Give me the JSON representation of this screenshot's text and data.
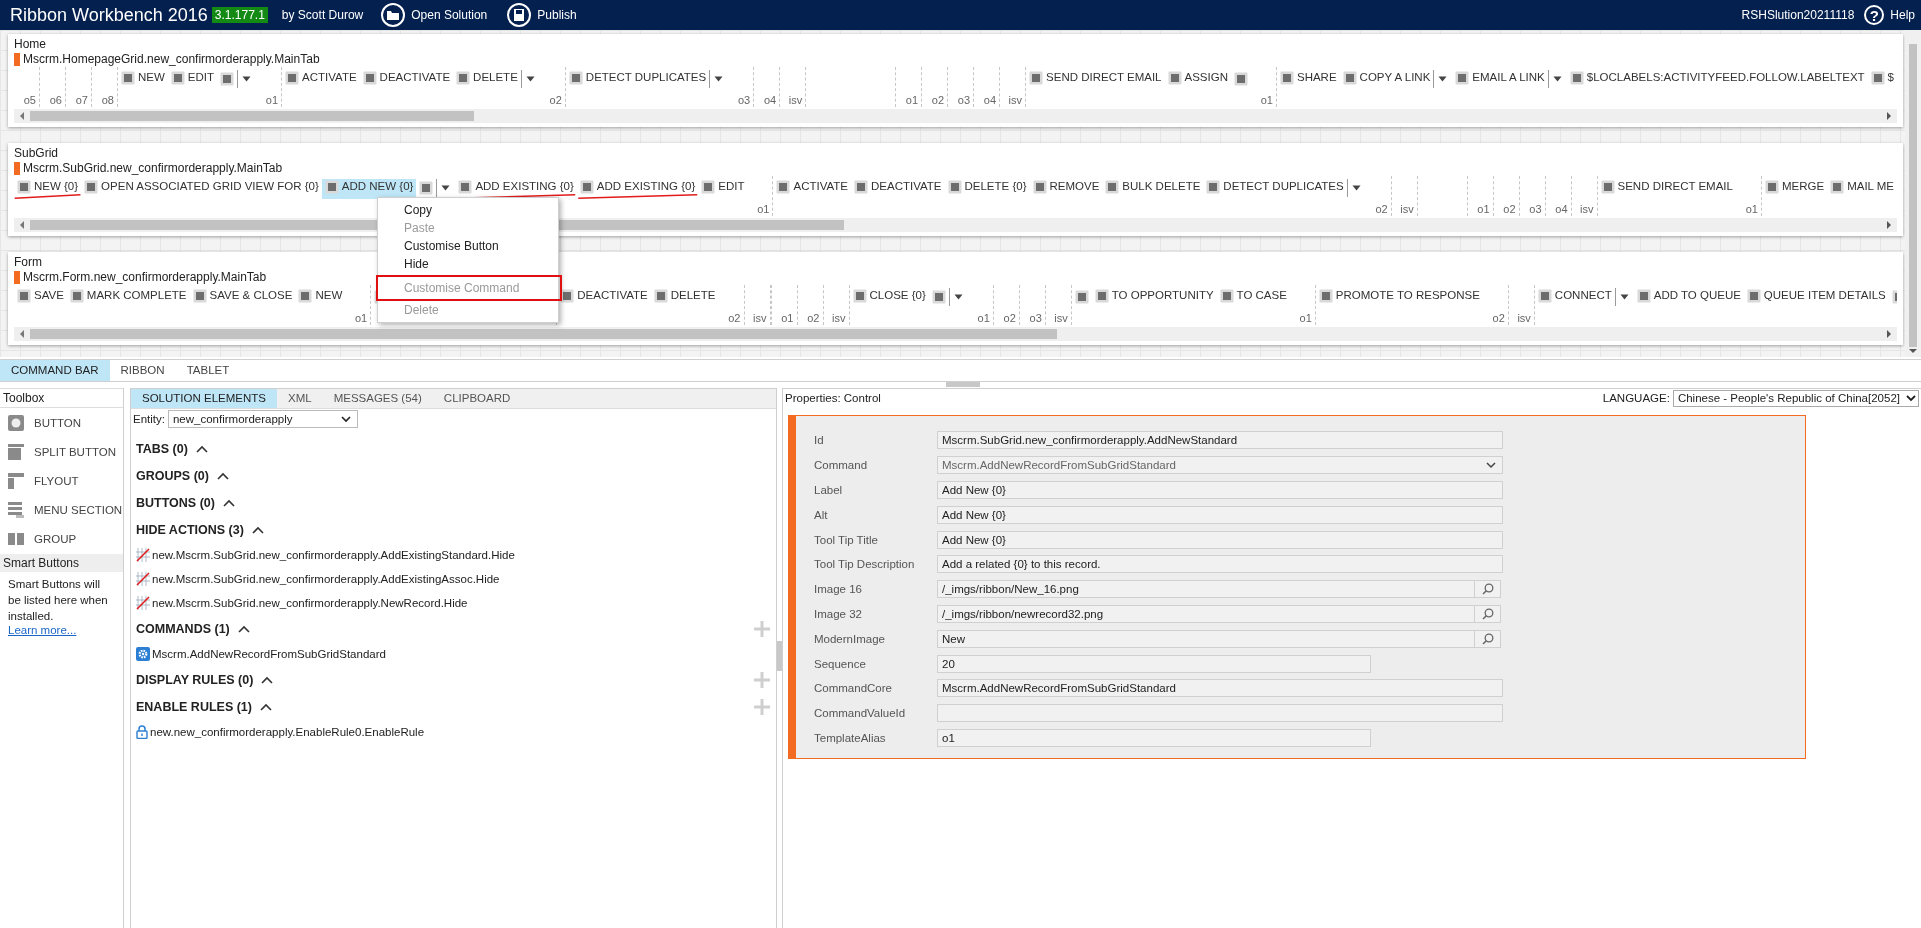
{
  "header": {
    "title": "Ribbon Workbench 2016",
    "version": "3.1.177.1",
    "author": "by Scott Durow",
    "actions": [
      {
        "label": "Open Solution",
        "kind": "open"
      },
      {
        "label": "Publish",
        "kind": "publish"
      }
    ],
    "solution": "RSHSlution20211118",
    "help": {
      "icon": "?",
      "label": "Help"
    }
  },
  "ribbons": [
    {
      "title": "Home",
      "tab": "Mscrm.HomepageGrid.new_confirmorderapply.MainTab",
      "items": [
        {
          "kind": "slot",
          "label": "o5"
        },
        {
          "kind": "slot",
          "label": "o6"
        },
        {
          "kind": "slot",
          "label": "o7"
        },
        {
          "kind": "slot",
          "label": "o8"
        },
        {
          "kind": "button",
          "label": "NEW",
          "selected": false,
          "struck": false
        },
        {
          "kind": "button",
          "label": "EDIT",
          "selected": false,
          "struck": false
        },
        {
          "kind": "icon"
        },
        {
          "kind": "dropdown"
        },
        {
          "kind": "slot",
          "label": "o1"
        },
        {
          "kind": "button",
          "label": "ACTIVATE",
          "selected": false,
          "struck": false
        },
        {
          "kind": "button",
          "label": "DEACTIVATE",
          "selected": false,
          "struck": false
        },
        {
          "kind": "button",
          "label": "DELETE",
          "selected": false,
          "struck": false
        },
        {
          "kind": "dropdown"
        },
        {
          "kind": "slot",
          "label": "o2"
        },
        {
          "kind": "button",
          "label": "DETECT DUPLICATES",
          "selected": false,
          "struck": false
        },
        {
          "kind": "dropdown"
        },
        {
          "kind": "slot",
          "label": "o3"
        },
        {
          "kind": "slot",
          "label": "o4"
        },
        {
          "kind": "slot",
          "label": "isv"
        },
        {
          "kind": "blank"
        },
        {
          "kind": "slot",
          "label": "o1"
        },
        {
          "kind": "slot",
          "label": "o2"
        },
        {
          "kind": "slot",
          "label": "o3"
        },
        {
          "kind": "slot",
          "label": "o4"
        },
        {
          "kind": "slot",
          "label": "isv"
        },
        {
          "kind": "button",
          "label": "SEND DIRECT EMAIL",
          "selected": false,
          "struck": false
        },
        {
          "kind": "button",
          "label": "ASSIGN",
          "selected": false,
          "struck": false
        },
        {
          "kind": "icon"
        },
        {
          "kind": "slot",
          "label": "o1"
        },
        {
          "kind": "button",
          "label": "SHARE",
          "selected": false,
          "struck": false
        },
        {
          "kind": "button",
          "label": "COPY A LINK",
          "selected": false,
          "struck": false
        },
        {
          "kind": "dropdown"
        },
        {
          "kind": "button",
          "label": "EMAIL A LINK",
          "selected": false,
          "struck": false
        },
        {
          "kind": "dropdown"
        },
        {
          "kind": "button",
          "label": "$LOCLABELS:ACTIVITYFEED.FOLLOW.LABELTEXT",
          "selected": false,
          "struck": false
        },
        {
          "kind": "button",
          "label": "$",
          "selected": false,
          "struck": false
        }
      ]
    },
    {
      "title": "SubGrid",
      "tab": "Mscrm.SubGrid.new_confirmorderapply.MainTab",
      "items": [
        {
          "kind": "button",
          "label": "NEW {0}",
          "selected": false,
          "struck": true
        },
        {
          "kind": "button",
          "label": "OPEN ASSOCIATED GRID VIEW FOR {0}",
          "selected": false,
          "struck": false
        },
        {
          "kind": "button",
          "label": "ADD NEW {0}",
          "selected": true,
          "struck": false
        },
        {
          "kind": "icon"
        },
        {
          "kind": "dropdown"
        },
        {
          "kind": "button",
          "label": "ADD EXISTING {0}",
          "selected": false,
          "struck": true
        },
        {
          "kind": "button",
          "label": "ADD EXISTING {0}",
          "selected": false,
          "struck": true
        },
        {
          "kind": "button",
          "label": "EDIT",
          "selected": false,
          "struck": false
        },
        {
          "kind": "slot",
          "label": "o1"
        },
        {
          "kind": "button",
          "label": "ACTIVATE",
          "selected": false,
          "struck": false
        },
        {
          "kind": "button",
          "label": "DEACTIVATE",
          "selected": false,
          "struck": false
        },
        {
          "kind": "button",
          "label": "DELETE {0}",
          "selected": false,
          "struck": false
        },
        {
          "kind": "button",
          "label": "REMOVE",
          "selected": false,
          "struck": false
        },
        {
          "kind": "button",
          "label": "BULK DELETE",
          "selected": false,
          "struck": false
        },
        {
          "kind": "button",
          "label": "DETECT DUPLICATES",
          "selected": false,
          "struck": false
        },
        {
          "kind": "dropdown"
        },
        {
          "kind": "slot",
          "label": "o2"
        },
        {
          "kind": "slot",
          "label": "isv"
        },
        {
          "kind": "blank"
        },
        {
          "kind": "slot",
          "label": "o1"
        },
        {
          "kind": "slot",
          "label": "o2"
        },
        {
          "kind": "slot",
          "label": "o3"
        },
        {
          "kind": "slot",
          "label": "o4"
        },
        {
          "kind": "slot",
          "label": "isv"
        },
        {
          "kind": "button",
          "label": "SEND DIRECT EMAIL",
          "selected": false,
          "struck": false
        },
        {
          "kind": "slot",
          "label": "o1"
        },
        {
          "kind": "button",
          "label": "MERGE",
          "selected": false,
          "struck": false
        },
        {
          "kind": "button",
          "label": "MAIL ME",
          "selected": false,
          "struck": false
        }
      ]
    },
    {
      "title": "Form",
      "tab": "Mscrm.Form.new_confirmorderapply.MainTab",
      "items": [
        {
          "kind": "button",
          "label": "SAVE",
          "selected": false,
          "struck": false
        },
        {
          "kind": "button",
          "label": "MARK COMPLETE",
          "selected": false,
          "struck": false
        },
        {
          "kind": "button",
          "label": "SAVE & CLOSE",
          "selected": false,
          "struck": false
        },
        {
          "kind": "button",
          "label": "NEW",
          "selected": false,
          "struck": false
        },
        {
          "kind": "slot",
          "label": "o1"
        },
        {
          "kind": "icon"
        },
        {
          "kind": "blank"
        },
        {
          "kind": "button",
          "label": "DEACTIVATE",
          "selected": false,
          "struck": false
        },
        {
          "kind": "button",
          "label": "DELETE",
          "selected": false,
          "struck": false
        },
        {
          "kind": "slot",
          "label": "o2"
        },
        {
          "kind": "slot",
          "label": "isv"
        },
        {
          "kind": "blank"
        },
        {
          "kind": "slot",
          "label": "o1"
        },
        {
          "kind": "slot",
          "label": "o2"
        },
        {
          "kind": "slot",
          "label": "isv"
        },
        {
          "kind": "button",
          "label": "CLOSE {0}",
          "selected": false,
          "struck": false
        },
        {
          "kind": "icon"
        },
        {
          "kind": "dropdown"
        },
        {
          "kind": "slot",
          "label": "o1"
        },
        {
          "kind": "slot",
          "label": "o2"
        },
        {
          "kind": "slot",
          "label": "o3"
        },
        {
          "kind": "slot",
          "label": "isv"
        },
        {
          "kind": "icon"
        },
        {
          "kind": "button",
          "label": "TO OPPORTUNITY",
          "selected": false,
          "struck": false
        },
        {
          "kind": "button",
          "label": "TO CASE",
          "selected": false,
          "struck": false
        },
        {
          "kind": "slot",
          "label": "o1"
        },
        {
          "kind": "button",
          "label": "PROMOTE TO RESPONSE",
          "selected": false,
          "struck": false
        },
        {
          "kind": "slot",
          "label": "o2"
        },
        {
          "kind": "slot",
          "label": "isv"
        },
        {
          "kind": "button",
          "label": "CONNECT",
          "selected": false,
          "struck": false
        },
        {
          "kind": "dropdown"
        },
        {
          "kind": "button",
          "label": "ADD TO QUEUE",
          "selected": false,
          "struck": false
        },
        {
          "kind": "button",
          "label": "QUEUE ITEM DETAILS",
          "selected": false,
          "struck": false
        },
        {
          "kind": "icon"
        }
      ]
    }
  ],
  "context_menu": {
    "items": [
      {
        "label": "Copy",
        "disabled": false,
        "outlined": false
      },
      {
        "label": "Paste",
        "disabled": true,
        "outlined": false
      },
      {
        "label": "Customise Button",
        "disabled": false,
        "outlined": false
      },
      {
        "label": "Hide",
        "disabled": false,
        "outlined": false
      },
      {
        "label": "Customise Command",
        "disabled": true,
        "outlined": true
      },
      {
        "label": "Delete",
        "disabled": true,
        "outlined": false
      }
    ]
  },
  "view_tabs": [
    {
      "label": "COMMAND BAR",
      "selected": true
    },
    {
      "label": "RIBBON",
      "selected": false
    },
    {
      "label": "TABLET",
      "selected": false
    }
  ],
  "toolbox": {
    "title": "Toolbox",
    "items": [
      {
        "label": "BUTTON",
        "kind": "button"
      },
      {
        "label": "SPLIT BUTTON",
        "kind": "split"
      },
      {
        "label": "FLYOUT",
        "kind": "flyout"
      },
      {
        "label": "MENU SECTION",
        "kind": "section"
      },
      {
        "label": "GROUP",
        "kind": "group"
      }
    ],
    "smart_title": "Smart Buttons",
    "smart_text": "Smart Buttons will be listed here when installed.",
    "link": "Learn more..."
  },
  "solution": {
    "tabs": [
      {
        "label": "SOLUTION ELEMENTS",
        "selected": true
      },
      {
        "label": "XML",
        "selected": false
      },
      {
        "label": "MESSAGES (54)",
        "selected": false
      },
      {
        "label": "CLIPBOARD",
        "selected": false
      }
    ],
    "entity_label": "Entity:",
    "entity": "new_confirmorderapply",
    "sections": [
      {
        "title": "TABS (0)",
        "expanded": true,
        "addable": false
      },
      {
        "title": "GROUPS (0)",
        "expanded": true,
        "addable": false
      },
      {
        "title": "BUTTONS (0)",
        "expanded": true,
        "addable": false
      },
      {
        "title": "HIDE ACTIONS (3)",
        "expanded": true,
        "addable": false,
        "items": [
          {
            "label": "new.Mscrm.SubGrid.new_confirmorderapply.AddExistingStandard.Hide",
            "kind": "hide"
          },
          {
            "label": "new.Mscrm.SubGrid.new_confirmorderapply.AddExistingAssoc.Hide",
            "kind": "hide"
          },
          {
            "label": "new.Mscrm.SubGrid.new_confirmorderapply.NewRecord.Hide",
            "kind": "hide"
          }
        ]
      },
      {
        "title": "COMMANDS (1)",
        "expanded": true,
        "addable": true,
        "items": [
          {
            "label": "Mscrm.AddNewRecordFromSubGridStandard",
            "kind": "command"
          }
        ]
      },
      {
        "title": "DISPLAY RULES (0)",
        "expanded": true,
        "addable": true
      },
      {
        "title": "ENABLE RULES (1)",
        "expanded": true,
        "addable": true,
        "items": [
          {
            "label": "new.new_confirmorderapply.EnableRule0.EnableRule",
            "kind": "rule"
          }
        ]
      }
    ]
  },
  "properties": {
    "title": "Properties: Control",
    "language_label": "LANGUAGE:",
    "language": "Chinese - People's Republic of China[2052]",
    "fields": [
      {
        "label": "Id",
        "kind": "text",
        "value": "Mscrm.SubGrid.new_confirmorderapply.AddNewStandard"
      },
      {
        "label": "Command",
        "kind": "select",
        "value": "Mscrm.AddNewRecordFromSubGridStandard"
      },
      {
        "label": "Label",
        "kind": "text",
        "value": "Add New {0}"
      },
      {
        "label": "Alt",
        "kind": "text",
        "value": "Add New {0}"
      },
      {
        "label": "Tool Tip Title",
        "kind": "text",
        "value": "Add New {0}"
      },
      {
        "label": "Tool Tip Description",
        "kind": "text",
        "value": "Add a related {0} to this record."
      },
      {
        "label": "Image 16",
        "kind": "lookup",
        "value": "/_imgs/ribbon/New_16.png"
      },
      {
        "label": "Image 32",
        "kind": "lookup",
        "value": "/_imgs/ribbon/newrecord32.png"
      },
      {
        "label": "ModernImage",
        "kind": "lookup",
        "value": "New"
      },
      {
        "label": "Sequence",
        "kind": "short",
        "value": "20"
      },
      {
        "label": "CommandCore",
        "kind": "text",
        "value": "Mscrm.AddNewRecordFromSubGridStandard"
      },
      {
        "label": "CommandValueId",
        "kind": "text"
      },
      {
        "label": "TemplateAlias",
        "kind": "short",
        "value": "o1"
      }
    ]
  }
}
